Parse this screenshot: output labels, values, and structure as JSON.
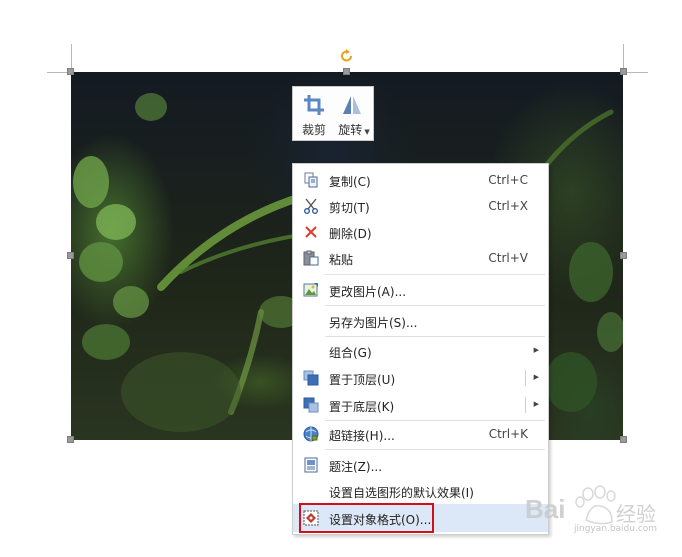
{
  "mini_toolbar": {
    "crop_label": "裁剪",
    "rotate_label": "旋转"
  },
  "context_menu": {
    "items": [
      {
        "label": "复制(C)",
        "shortcut": "Ctrl+C",
        "icon": "copy-icon"
      },
      {
        "label": "剪切(T)",
        "shortcut": "Ctrl+X",
        "icon": "scissors-icon"
      },
      {
        "label": "删除(D)",
        "shortcut": "",
        "icon": "delete-icon"
      },
      {
        "label": "粘贴",
        "shortcut": "Ctrl+V",
        "icon": "paste-icon"
      },
      {
        "label": "更改图片(A)...",
        "shortcut": "",
        "icon": "change-picture-icon"
      },
      {
        "label": "另存为图片(S)...",
        "shortcut": "",
        "icon": ""
      },
      {
        "label": "组合(G)",
        "shortcut": "",
        "icon": "",
        "submenu": true
      },
      {
        "label": "置于顶层(U)",
        "shortcut": "",
        "icon": "bring-to-front-icon",
        "submenu": true
      },
      {
        "label": "置于底层(K)",
        "shortcut": "",
        "icon": "send-to-back-icon",
        "submenu": true
      },
      {
        "label": "超链接(H)...",
        "shortcut": "Ctrl+K",
        "icon": "hyperlink-icon"
      },
      {
        "label": "题注(Z)...",
        "shortcut": "",
        "icon": "caption-icon"
      },
      {
        "label": "设置自选图形的默认效果(I)",
        "shortcut": "",
        "icon": ""
      },
      {
        "label": "设置对象格式(O)...",
        "shortcut": "",
        "icon": "format-object-icon",
        "active": true
      }
    ]
  },
  "colors": {
    "highlight_border": "#d0111b",
    "active_item_bg": "#dce7f7",
    "rotate_handle": "#e8a317"
  },
  "watermark": {
    "brand": "Bai",
    "text": "经验",
    "url": "jingyan.baidu.com"
  }
}
